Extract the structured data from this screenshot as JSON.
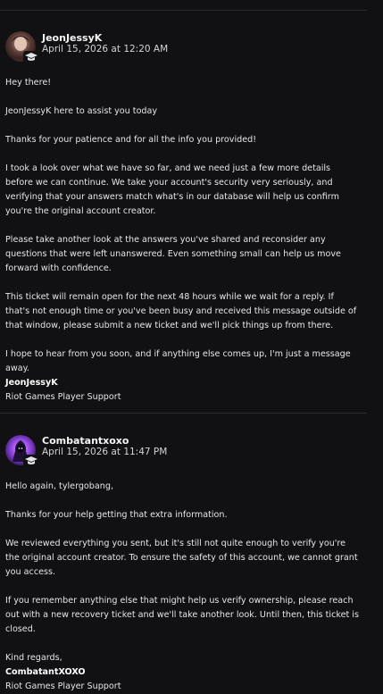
{
  "messages": [
    {
      "author": "JeonJessyK",
      "date": "April 15, 2026 at 12:20 AM",
      "paragraphs": [
        "Hey there!",
        "JeonJessyK here to assist you today",
        "Thanks for your patience and for all the info you provided!",
        "I took a look over what we have so far, and we need just a few more details before we can continue. We take your account's security very seriously, and verifying that your answers match what's in our database will help us confirm you're the original account creator.",
        "Please take another look at the answers you've shared and reconsider any questions that were left unanswered. Even something small can help us move forward with confidence.",
        "This ticket will remain open for the next 48 hours while we wait for a reply. If that's not enough time or you've been busy and received this message outside of that window, please submit a new ticket and we'll pick things up from there."
      ],
      "closing": "I hope to hear from you soon, and if anything else comes up, I'm just a message away.",
      "signature_name": "JeonJessyK",
      "signature_team": "Riot Games Player Support"
    },
    {
      "author": "Combatantxoxo",
      "date": "April 15, 2026 at 11:47 PM",
      "paragraphs": [
        "Hello again, tylergobang,",
        "Thanks for your help getting that extra information.",
        "We reviewed everything you sent, but it's still not quite enough to verify you're the original account creator. To ensure the safety of this account, we cannot grant you access.",
        "If you remember anything else that might help us verify ownership, please reach out with a new recovery ticket and we'll take another look. Until then, this ticket is closed."
      ],
      "closing": "Kind regards,",
      "signature_name": "CombatantXOXO",
      "signature_team": "Riot Games Player Support"
    }
  ],
  "colors": {
    "background": "#111113",
    "divider": "#2c2c30",
    "text": "#e6e6e8"
  },
  "icons": {
    "agent_badge": "graduation-cap-icon"
  }
}
